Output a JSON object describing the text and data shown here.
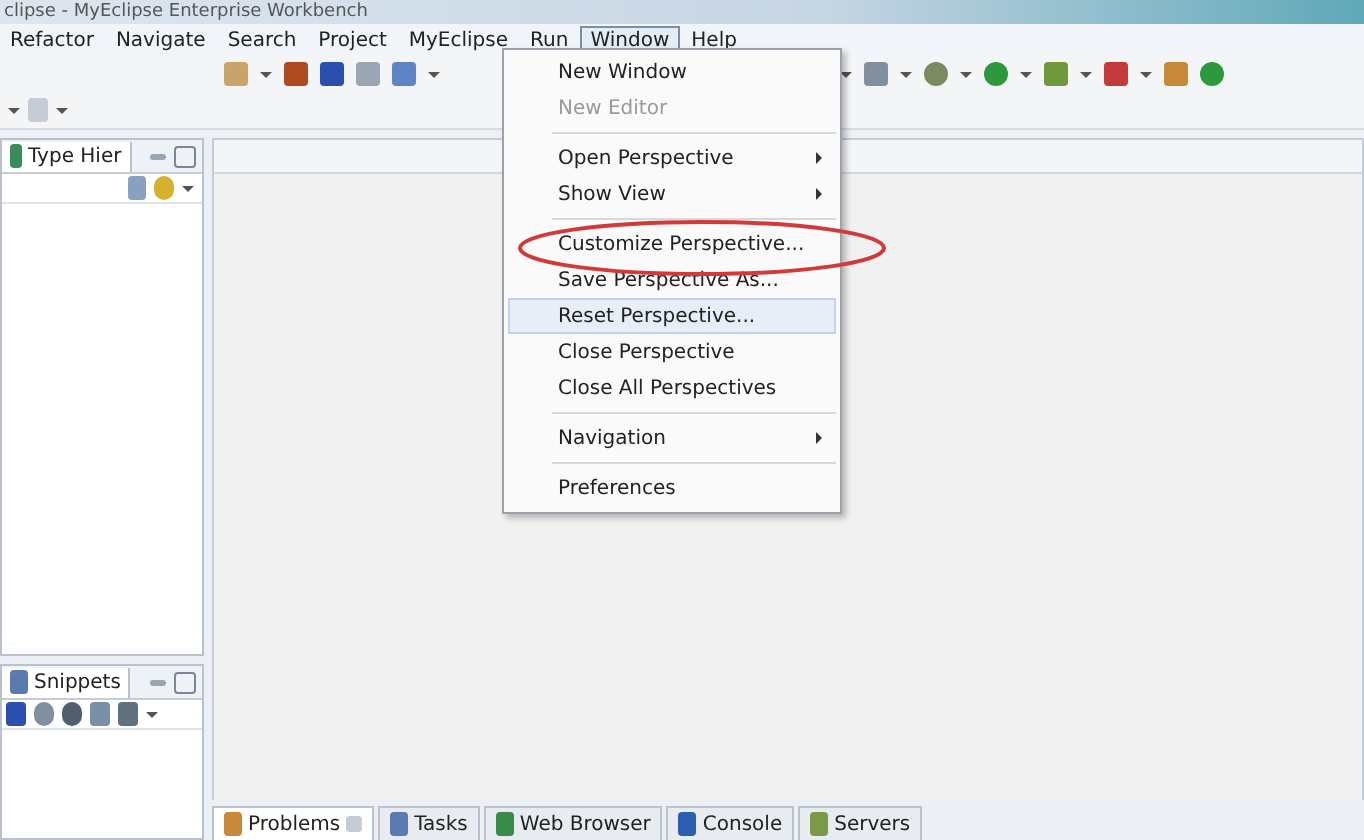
{
  "window": {
    "title": "clipse - MyEclipse Enterprise Workbench"
  },
  "menubar": [
    {
      "label": "Refactor",
      "selected": false
    },
    {
      "label": "Navigate",
      "selected": false
    },
    {
      "label": "Search",
      "selected": false
    },
    {
      "label": "Project",
      "selected": false
    },
    {
      "label": "MyEclipse",
      "selected": false
    },
    {
      "label": "Run",
      "selected": false
    },
    {
      "label": "Window",
      "selected": true
    },
    {
      "label": "Help",
      "selected": false
    }
  ],
  "window_menu": [
    {
      "kind": "item",
      "label": "New Window",
      "disabled": false,
      "selected": false,
      "submenu": false,
      "circled": false
    },
    {
      "kind": "item",
      "label": "New Editor",
      "disabled": true,
      "selected": false,
      "submenu": false,
      "circled": false
    },
    {
      "kind": "separator"
    },
    {
      "kind": "item",
      "label": "Open Perspective",
      "disabled": false,
      "selected": false,
      "submenu": true,
      "circled": false
    },
    {
      "kind": "item",
      "label": "Show View",
      "disabled": false,
      "selected": false,
      "submenu": true,
      "circled": false
    },
    {
      "kind": "separator"
    },
    {
      "kind": "item",
      "label": "Customize Perspective...",
      "disabled": false,
      "selected": false,
      "submenu": false,
      "circled": true
    },
    {
      "kind": "item",
      "label": "Save Perspective As...",
      "disabled": false,
      "selected": false,
      "submenu": false,
      "circled": false
    },
    {
      "kind": "item",
      "label": "Reset Perspective...",
      "disabled": false,
      "selected": true,
      "submenu": false,
      "circled": false
    },
    {
      "kind": "item",
      "label": "Close Perspective",
      "disabled": false,
      "selected": false,
      "submenu": false,
      "circled": false
    },
    {
      "kind": "item",
      "label": "Close All Perspectives",
      "disabled": false,
      "selected": false,
      "submenu": false,
      "circled": false
    },
    {
      "kind": "separator"
    },
    {
      "kind": "item",
      "label": "Navigation",
      "disabled": false,
      "selected": false,
      "submenu": true,
      "circled": false
    },
    {
      "kind": "separator"
    },
    {
      "kind": "item",
      "label": "Preferences",
      "disabled": false,
      "selected": false,
      "submenu": false,
      "circled": false
    }
  ],
  "left_top_panel": {
    "tab": "Type Hier"
  },
  "left_bottom_panel": {
    "tab": "Snippets"
  },
  "bottom_tabs": [
    {
      "label": "Problems",
      "selected": true,
      "closable": true
    },
    {
      "label": "Tasks",
      "selected": false,
      "closable": false
    },
    {
      "label": "Web Browser",
      "selected": false,
      "closable": false
    },
    {
      "label": "Console",
      "selected": false,
      "closable": false
    },
    {
      "label": "Servers",
      "selected": false,
      "closable": false
    }
  ]
}
